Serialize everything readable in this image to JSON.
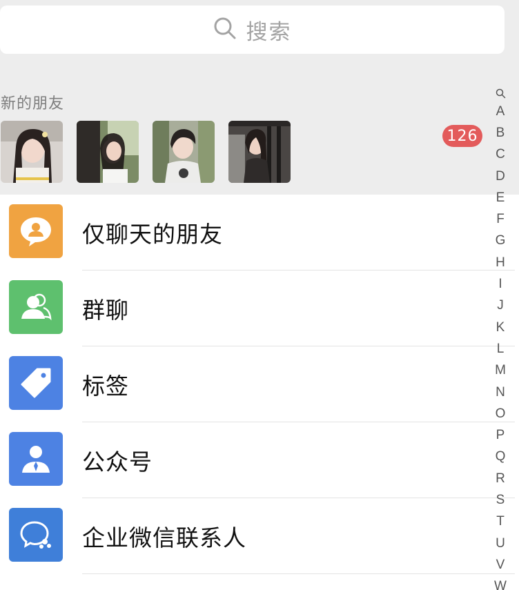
{
  "search": {
    "placeholder": "搜索",
    "icon": "search-icon"
  },
  "new_friends": {
    "title": "新的朋友",
    "badge_count": "126",
    "badge_color": "#e35b5b",
    "avatars": [
      "friend-photo-1",
      "friend-photo-2",
      "friend-photo-3",
      "friend-photo-4"
    ]
  },
  "list": [
    {
      "label": "仅聊天的朋友",
      "icon": "chat-only-friends-icon",
      "color": "#f0a341"
    },
    {
      "label": "群聊",
      "icon": "group-chat-icon",
      "color": "#5ec06e"
    },
    {
      "label": "标签",
      "icon": "tag-icon",
      "color": "#4d82e3"
    },
    {
      "label": "公众号",
      "icon": "official-account-icon",
      "color": "#4d82e3"
    },
    {
      "label": "企业微信联系人",
      "icon": "work-contacts-icon",
      "color": "#3f7fd9"
    }
  ],
  "alphabet": [
    "A",
    "B",
    "C",
    "D",
    "E",
    "F",
    "G",
    "H",
    "I",
    "J",
    "K",
    "L",
    "M",
    "N",
    "O",
    "P",
    "Q",
    "R",
    "S",
    "T",
    "U",
    "V",
    "W"
  ]
}
